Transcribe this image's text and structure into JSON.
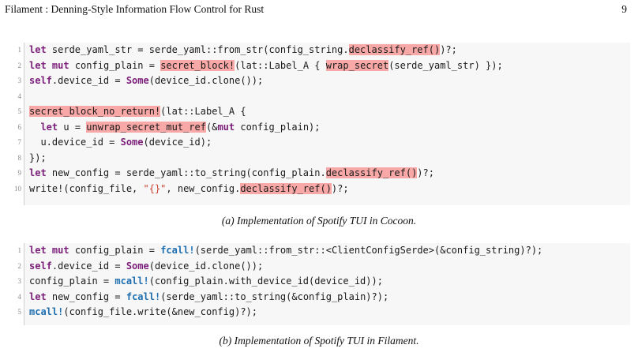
{
  "header": {
    "title": "Filament : Denning-Style Information Flow Control for Rust",
    "page_number": "9"
  },
  "listings": [
    {
      "caption": "(a) Implementation of Spotify TUI in Cocoon.",
      "lines": [
        {
          "num": "1",
          "segs": [
            {
              "t": "let",
              "k": "kw"
            },
            {
              "t": " serde_yaml_str = serde_yaml::from_str(config_string."
            },
            {
              "t": "declassify_ref()",
              "k": "hl"
            },
            {
              "t": ")?;"
            }
          ]
        },
        {
          "num": "2",
          "segs": [
            {
              "t": "let",
              "k": "kw"
            },
            {
              "t": " "
            },
            {
              "t": "mut",
              "k": "kw"
            },
            {
              "t": " config_plain = "
            },
            {
              "t": "secret_block!",
              "k": "hl"
            },
            {
              "t": "(lat::Label_A { "
            },
            {
              "t": "wrap_secret",
              "k": "hl"
            },
            {
              "t": "(serde_yaml_str) });"
            }
          ]
        },
        {
          "num": "3",
          "segs": [
            {
              "t": "self",
              "k": "kw"
            },
            {
              "t": ".device_id = "
            },
            {
              "t": "Some",
              "k": "kw"
            },
            {
              "t": "(device_id.clone());"
            }
          ]
        },
        {
          "num": "4",
          "segs": []
        },
        {
          "num": "5",
          "segs": [
            {
              "t": "secret_block_no_return!",
              "k": "hl"
            },
            {
              "t": "(lat::Label_A {"
            }
          ]
        },
        {
          "num": "6",
          "segs": [
            {
              "t": "  "
            },
            {
              "t": "let",
              "k": "kw"
            },
            {
              "t": " u = "
            },
            {
              "t": "unwrap_secret_mut_ref",
              "k": "hl"
            },
            {
              "t": "(&"
            },
            {
              "t": "mut",
              "k": "kw"
            },
            {
              "t": " config_plain);"
            }
          ]
        },
        {
          "num": "7",
          "segs": [
            {
              "t": "  u.device_id = "
            },
            {
              "t": "Some",
              "k": "kw"
            },
            {
              "t": "(device_id);"
            }
          ]
        },
        {
          "num": "8",
          "segs": [
            {
              "t": "});"
            }
          ]
        },
        {
          "num": "9",
          "segs": [
            {
              "t": "let",
              "k": "kw"
            },
            {
              "t": " new_config = serde_yaml::to_string(config_plain."
            },
            {
              "t": "declassify_ref()",
              "k": "hl"
            },
            {
              "t": ")?;"
            }
          ]
        },
        {
          "num": "10",
          "segs": [
            {
              "t": "write!(config_file, "
            },
            {
              "t": "\"{}\"",
              "k": "str"
            },
            {
              "t": ", new_config."
            },
            {
              "t": "declassify_ref()",
              "k": "hl"
            },
            {
              "t": ")?;"
            }
          ]
        }
      ]
    },
    {
      "caption": "(b) Implementation of Spotify TUI in Filament.",
      "lines": [
        {
          "num": "1",
          "segs": [
            {
              "t": "let",
              "k": "kw"
            },
            {
              "t": " "
            },
            {
              "t": "mut",
              "k": "kw"
            },
            {
              "t": " config_plain = "
            },
            {
              "t": "fcall!",
              "k": "macro"
            },
            {
              "t": "(serde_yaml::from_str::<ClientConfigSerde>(&config_string)?);"
            }
          ]
        },
        {
          "num": "2",
          "segs": [
            {
              "t": "self",
              "k": "kw"
            },
            {
              "t": ".device_id = "
            },
            {
              "t": "Some",
              "k": "kw"
            },
            {
              "t": "(device_id.clone());"
            }
          ]
        },
        {
          "num": "3",
          "segs": [
            {
              "t": "config_plain = "
            },
            {
              "t": "mcall!",
              "k": "macro"
            },
            {
              "t": "(config_plain.with_device_id(device_id));"
            }
          ]
        },
        {
          "num": "4",
          "segs": [
            {
              "t": "let",
              "k": "kw"
            },
            {
              "t": " new_config = "
            },
            {
              "t": "fcall!",
              "k": "macro"
            },
            {
              "t": "(serde_yaml::to_string(&config_plain)?);"
            }
          ]
        },
        {
          "num": "5",
          "segs": [
            {
              "t": "mcall!",
              "k": "macro"
            },
            {
              "t": "(config_file.write(&new_config)?);"
            }
          ]
        }
      ]
    }
  ]
}
